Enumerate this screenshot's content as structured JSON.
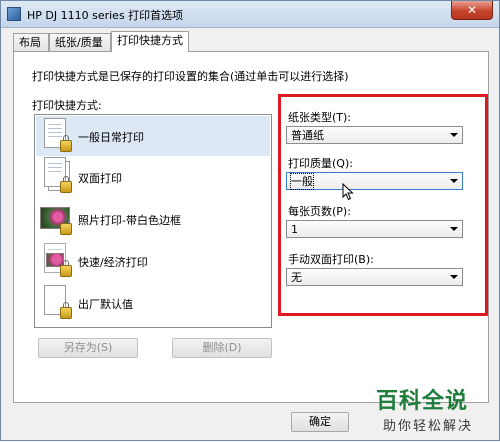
{
  "window": {
    "title": "HP DJ 1110 series 打印首选项",
    "close_label": "✕"
  },
  "tabs": [
    {
      "label": "布局"
    },
    {
      "label": "纸张/质量"
    },
    {
      "label": "打印快捷方式"
    }
  ],
  "panel": {
    "description": "打印快捷方式是已保存的打印设置的集合(通过单击可以进行选择)",
    "list_label": "打印快捷方式:",
    "shortcuts": [
      {
        "label": "一般日常打印",
        "icon": "document-lock-icon",
        "selected": true
      },
      {
        "label": "双面打印",
        "icon": "duplex-document-lock-icon"
      },
      {
        "label": "照片打印-带白色边框",
        "icon": "photo-lock-icon"
      },
      {
        "label": "快速/经济打印",
        "icon": "fast-economy-lock-icon"
      },
      {
        "label": "出厂默认值",
        "icon": "default-document-lock-icon"
      }
    ],
    "save_as_label": "另存为(S)",
    "delete_label": "删除(D)"
  },
  "settings": {
    "paper_type": {
      "label": "纸张类型(T):",
      "value": "普通纸"
    },
    "print_quality": {
      "label": "打印质量(Q):",
      "value": "一般"
    },
    "pages_per_sheet": {
      "label": "每张页数(P):",
      "value": "1"
    },
    "manual_duplex": {
      "label": "手动双面打印(B):",
      "value": "无"
    }
  },
  "footer": {
    "ok_label": "确定"
  },
  "watermark": {
    "title": "百科全说",
    "subtitle": "助你轻松解决"
  },
  "colors": {
    "highlight_box": "#e01822",
    "watermark_green": "#1f7d3a"
  }
}
